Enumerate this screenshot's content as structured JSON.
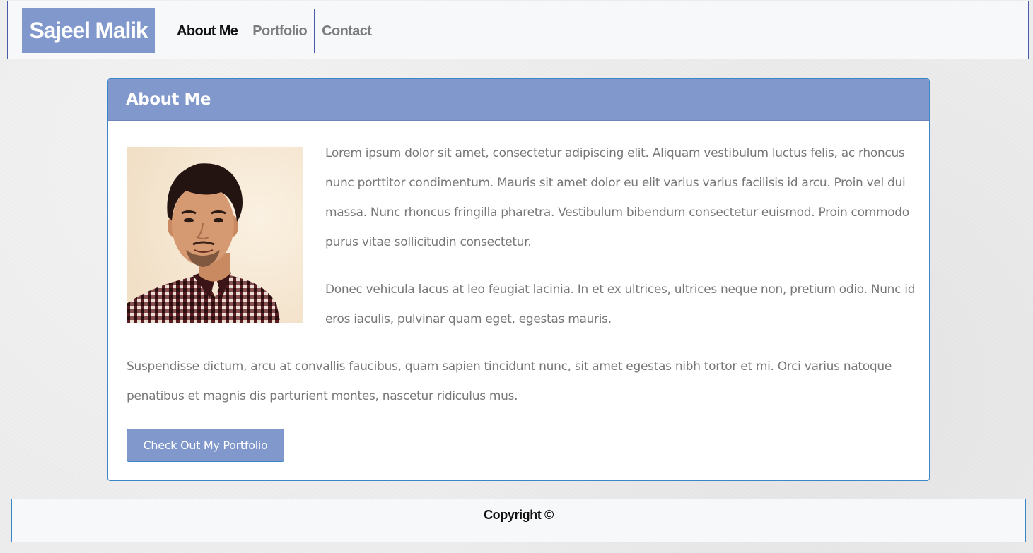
{
  "navbar": {
    "brand": "Sajeel Malik",
    "items": [
      {
        "label": "About Me",
        "active": true
      },
      {
        "label": "Portfolio",
        "active": false
      },
      {
        "label": "Contact",
        "active": false
      }
    ]
  },
  "about": {
    "title": "About Me",
    "photo_icon": "profile-photo",
    "paragraphs": [
      "Lorem ipsum dolor sit amet, consectetur adipiscing elit. Aliquam vestibulum luctus felis, ac rhoncus nunc porttitor condimentum. Mauris sit amet dolor eu elit varius varius facilisis id arcu. Proin vel dui massa. Nunc rhoncus fringilla pharetra. Vestibulum bibendum consectetur euismod. Proin commodo purus vitae sollicitudin consectetur.",
      "Donec vehicula lacus at leo feugiat lacinia. In et ex ultrices, ultrices neque non, pretium odio. Nunc id eros iaculis, pulvinar quam eget, egestas mauris.",
      "Suspendisse dictum, arcu at convallis faucibus, quam sapien tincidunt nunc, sit amet egestas nibh tortor et mi. Orci varius natoque penatibus et magnis dis parturient montes, nascetur ridiculus mus."
    ],
    "button_label": "Check Out My Portfolio"
  },
  "footer": {
    "copyright": "Copyright ©"
  },
  "colors": {
    "accent": "#8198cd",
    "border": "#3b86c6",
    "nav_border": "#4b5aa8",
    "text": "#777777"
  }
}
